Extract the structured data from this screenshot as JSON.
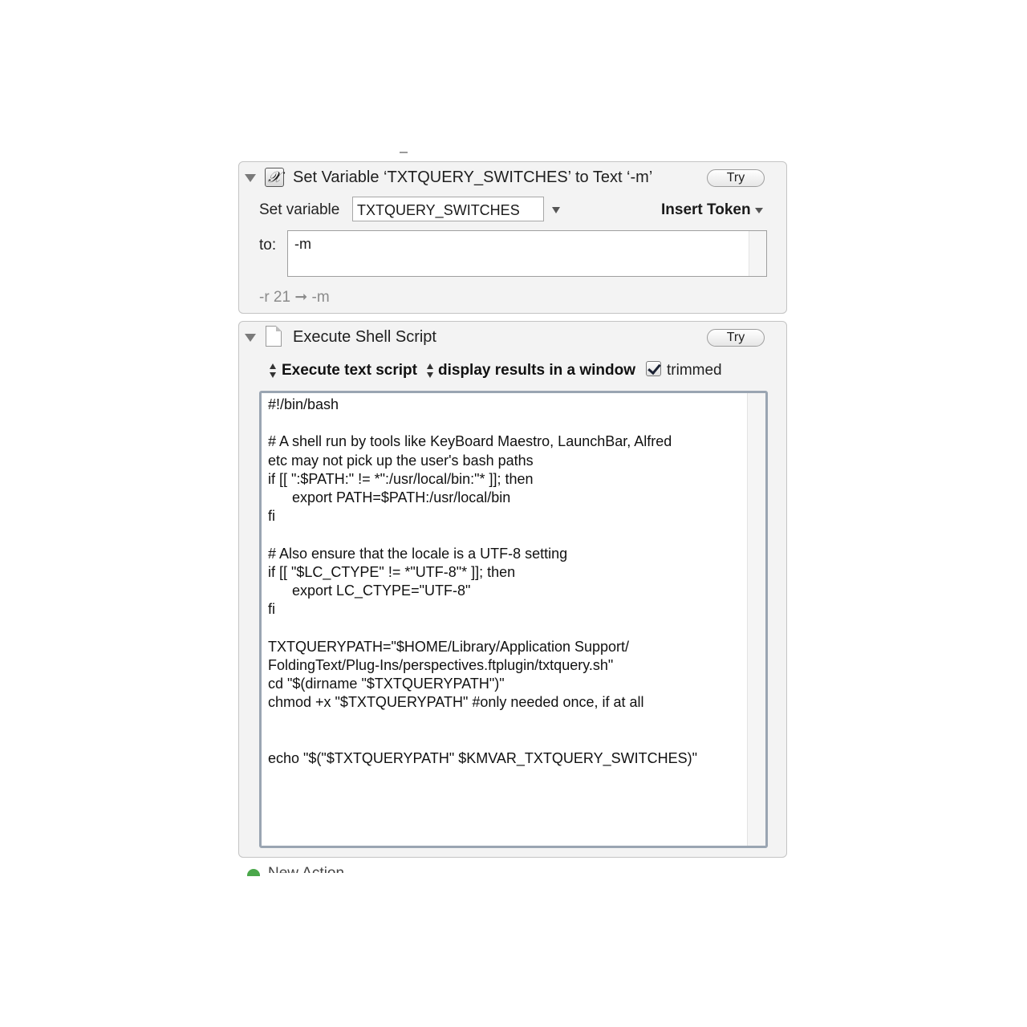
{
  "set_variable_action": {
    "title": "Set Variable ‘TXTQUERY_SWITCHES’ to Text ‘-m’",
    "try_label": "Try",
    "set_variable_label": "Set variable",
    "variable_name": "TXTQUERY_SWITCHES",
    "insert_token_label": "Insert Token",
    "to_label": "to:",
    "to_value": "-m",
    "preview": "-r 21 ➞ -m",
    "icon": "variable-x-icon"
  },
  "shell_action": {
    "title": "Execute Shell Script",
    "try_label": "Try",
    "mode_label": "Execute text script",
    "output_label": "display results in a window",
    "trimmed_label": "trimmed",
    "trimmed_checked": true,
    "icon": "document-icon",
    "script_lines": [
      "#!/bin/bash",
      "",
      "# A shell run by tools like KeyBoard Maestro, LaunchBar, Alfred",
      "etc may not pick up the user's bash paths",
      "if [[ \":$PATH:\" != *\":/usr/local/bin:\"* ]]; then",
      "      export PATH=$PATH:/usr/local/bin",
      "fi",
      "",
      "# Also ensure that the locale is a UTF-8 setting",
      "if [[ \"$LC_CTYPE\" != *\"UTF-8\"* ]]; then",
      "      export LC_CTYPE=\"UTF-8\"",
      "fi",
      "",
      "TXTQUERYPATH=\"$HOME/Library/Application Support/",
      "FoldingText/Plug-Ins/perspectives.ftplugin/txtquery.sh\"",
      "cd \"$(dirname \"$TXTQUERYPATH\")\"",
      "chmod +x \"$TXTQUERYPATH\" #only needed once, if at all",
      "",
      "",
      "echo \"$(\"$TXTQUERYPATH\" $KMVAR_TXTQUERY_SWITCHES)\""
    ]
  },
  "new_action_label": "New Action"
}
